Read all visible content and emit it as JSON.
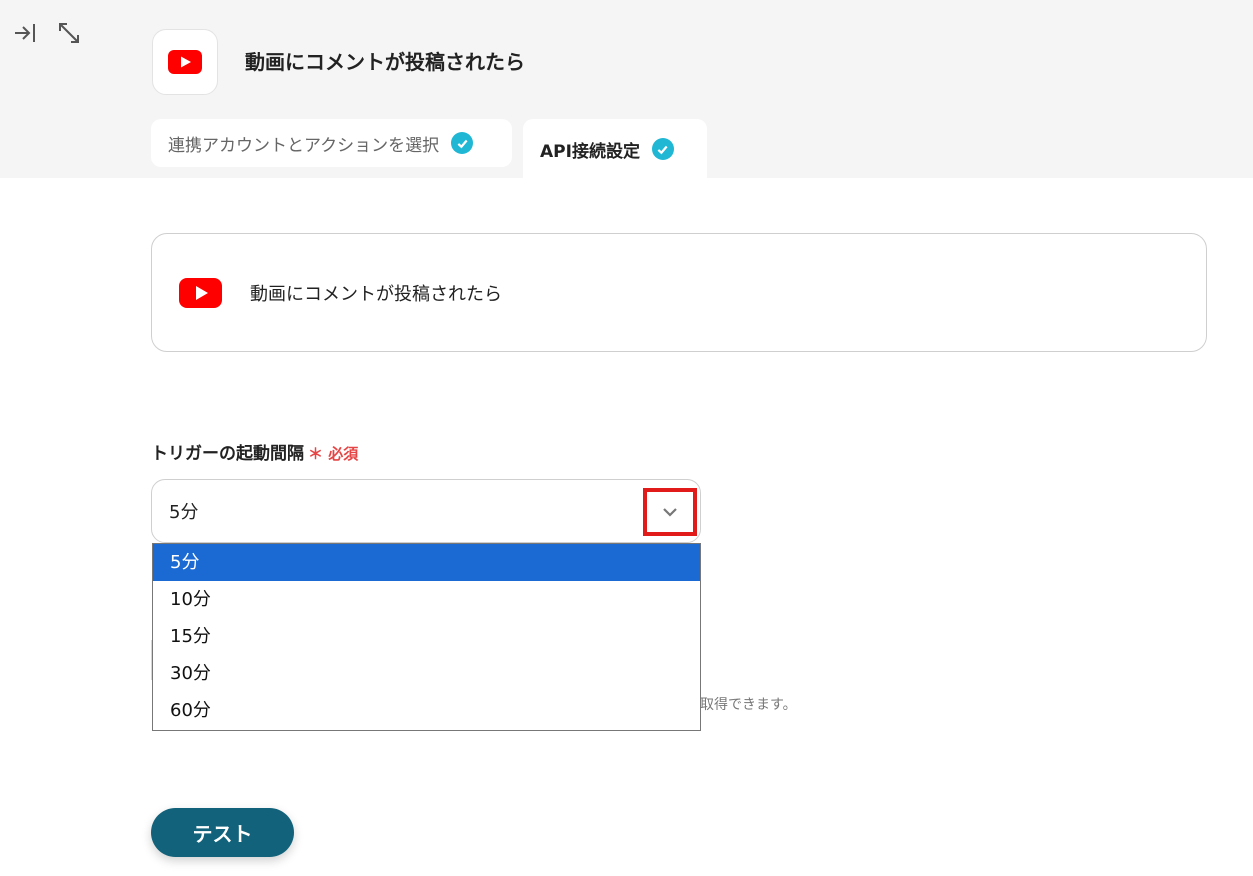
{
  "header": {
    "title": "動画にコメントが投稿されたら",
    "icons": [
      "collapse-panel-icon",
      "expand-icon"
    ]
  },
  "tabs": [
    {
      "label": "連携アカウントとアクションを選択",
      "completed": true
    },
    {
      "label": "API接続設定",
      "completed": true,
      "active": true
    }
  ],
  "trigger": {
    "app": "YouTube",
    "label": "動画にコメントが投稿されたら"
  },
  "interval_field": {
    "label": "トリガーの起動間隔",
    "required_mark": "＊",
    "required_text": "必須",
    "value": "5分",
    "options": [
      "5分",
      "10分",
      "15分",
      "30分",
      "60分"
    ],
    "selected_index": 0
  },
  "help": {
    "partial_text": "ら取得できます。"
  },
  "actions": {
    "test_label": "テスト"
  },
  "colors": {
    "accent": "#11627a",
    "check": "#1fb7d4",
    "selected_option": "#1b6ad4",
    "highlight_border": "#e11a1a",
    "required": "#e64545",
    "youtube_red": "#ff0000"
  }
}
